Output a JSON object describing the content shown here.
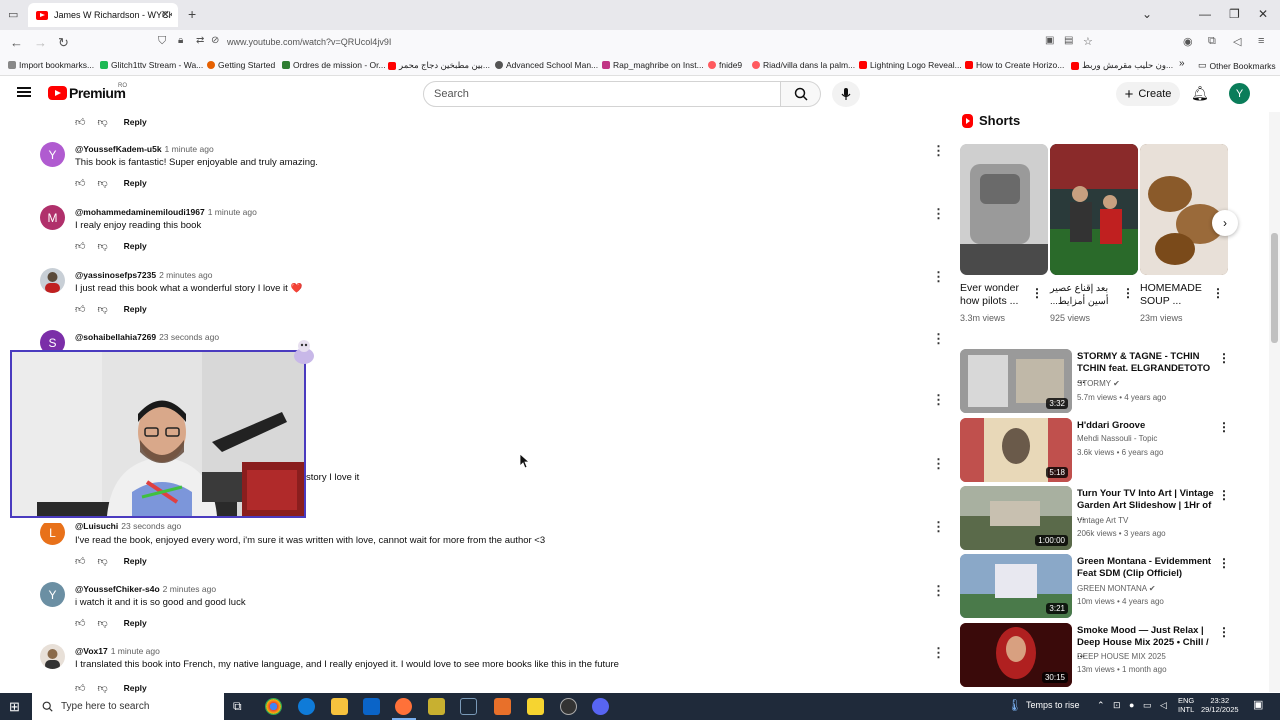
{
  "browser": {
    "tab_title": "James W Richardson - WYCKEL",
    "url": "www.youtube.com/watch?v=QRUcol4jv9I",
    "bookmarks": [
      {
        "label": "Import bookmarks...",
        "color": "#888"
      },
      {
        "label": "Glitch1ttv Stream - Wa...",
        "color": "#1db954"
      },
      {
        "label": "Getting Started",
        "color": "#e66000"
      },
      {
        "label": "Ordres de mission - Or...",
        "color": "#2e7d32"
      },
      {
        "label": "بين مطبخين دجاج محمر...",
        "color": "#f00"
      },
      {
        "label": "Advanced School Man...",
        "color": "#555"
      },
      {
        "label": "Rap_maghribe on Inst...",
        "color": "#c13584"
      },
      {
        "label": "fnide9",
        "color": "#ff5a5f"
      },
      {
        "label": "Riad/villa dans la palm...",
        "color": "#ff5a5f"
      },
      {
        "label": "Lightning Logo Reveal...",
        "color": "#f00"
      },
      {
        "label": "How to Create Horizo...",
        "color": "#f00"
      },
      {
        "label": "ون حليب مقرمش وربط...",
        "color": "#f00"
      }
    ],
    "other_bookmarks": "Other Bookmarks"
  },
  "header": {
    "brand": "Premium",
    "region": "RO",
    "search_placeholder": "Search",
    "create_label": "Create",
    "avatar_letter": "Y"
  },
  "comments": [
    {
      "handle": "",
      "time": "",
      "text": "",
      "avatar": "",
      "avatar_color": "",
      "reply": "Reply"
    },
    {
      "handle": "@YoussefKadem-u5k",
      "time": "1 minute ago",
      "text": "This book is fantastic! Super enjoyable and truly amazing.",
      "avatar": "Y",
      "avatar_color": "#b05bd0",
      "reply": "Reply"
    },
    {
      "handle": "@mohammedaminemiloudi1967",
      "time": "1 minute ago",
      "text": "I realy enjoy reading this book",
      "avatar": "M",
      "avatar_color": "#b0306b",
      "reply": "Reply"
    },
    {
      "handle": "@yassinosefps7235",
      "time": "2 minutes ago",
      "text": "I just read this book what a wonderful story I love it ❤️",
      "avatar": "",
      "avatar_color": "#9aa",
      "reply": "Reply"
    },
    {
      "handle": "@sohaibellahia7269",
      "time": "23 seconds ago",
      "text": "",
      "avatar": "S",
      "avatar_color": "#7b2ea8",
      "reply": ""
    },
    {
      "handle": "",
      "time": "",
      "text": "",
      "avatar": "",
      "avatar_color": "",
      "reply": ""
    },
    {
      "handle": "",
      "time": "",
      "text": "story I love it",
      "avatar": "",
      "avatar_color": "",
      "reply": ""
    },
    {
      "handle": "@Luisuchi",
      "time": "23 seconds ago",
      "text": "I've read the book, enjoyed every word, i'm sure it was written with love, cannot wait for more from the author <3",
      "avatar": "L",
      "avatar_color": "#e8711a",
      "reply": "Reply"
    },
    {
      "handle": "@YoussefChiker-s4o",
      "time": "2 minutes ago",
      "text": "i watch it and it is so good and good luck",
      "avatar": "Y",
      "avatar_color": "#6b8fa3",
      "reply": "Reply"
    },
    {
      "handle": "@Vox17",
      "time": "1 minute ago",
      "text": "I translated this book into French, my native language, and I really enjoyed it. I would love to see more books like this in the future",
      "avatar": "",
      "avatar_color": "#c9a",
      "reply": "Reply"
    }
  ],
  "shorts": {
    "title": "Shorts",
    "items": [
      {
        "title": "Ever wonder how pilots ...",
        "views": "3.3m views",
        "color": "#b8b8b8"
      },
      {
        "title": "بعد إقناع عصير أسين أمزايط...",
        "views": "925 views",
        "color": "#3a4a3a"
      },
      {
        "title": "HOMEMADE SOUP ...",
        "views": "23m views",
        "color": "#6b4a2a"
      }
    ]
  },
  "videos": [
    {
      "title": "STORMY & TAGNE - TCHIN TCHIN feat. ELGRANDETOTO ...",
      "channel": "STORMY",
      "verified": true,
      "meta": "5.7m views • 4 years ago",
      "duration": "3:32",
      "color": "#8a8a8a"
    },
    {
      "title": "H'ddari Groove",
      "channel": "Mehdi Nassouli - Topic",
      "verified": false,
      "meta": "3.6k views • 6 years ago",
      "duration": "5:18",
      "color": "#c0504d"
    },
    {
      "title": "Turn Your TV Into Art | Vintage Garden Art Slideshow | 1Hr of ...",
      "channel": "Vintage Art TV",
      "verified": false,
      "meta": "206k views • 3 years ago",
      "duration": "1:00:00",
      "color": "#7a8a6a"
    },
    {
      "title": "Green Montana - Evidemment Feat SDM (Clip Officiel)",
      "channel": "GREEN MONTANA",
      "verified": true,
      "meta": "10m views • 4 years ago",
      "duration": "3:21",
      "color": "#5a7a9a"
    },
    {
      "title": "Smoke Mood — Just Relax | Deep House Mix 2025 • Chill / ...",
      "channel": "DEEP HOUSE MIX 2025",
      "verified": false,
      "meta": "13m views • 1 month ago",
      "duration": "30:15",
      "color": "#8a1a1a"
    }
  ],
  "taskbar": {
    "search_placeholder": "Type here to search",
    "weather": "Temps to rise",
    "lang_top": "ENG",
    "lang_bottom": "INTL",
    "time": "23:32",
    "date": "29/12/2025"
  }
}
